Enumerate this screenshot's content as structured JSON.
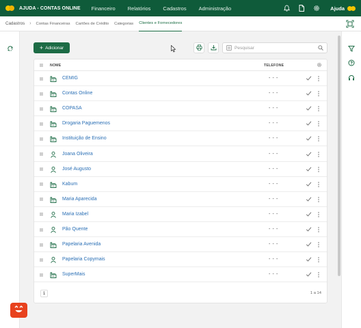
{
  "header": {
    "brand": "AJUDA - CONTAS ONLINE",
    "nav": [
      "Financeiro",
      "Relatórios",
      "Cadastros",
      "Administração"
    ],
    "help_label": "Ajuda",
    "icons": [
      "bell-icon",
      "document-icon",
      "gear-icon"
    ]
  },
  "tabs": {
    "breadcrumb": "Cadastros",
    "items": [
      "Contas Financeiras",
      "Cartões de Crédito",
      "Categorias",
      "Clientes e Fornecedores"
    ],
    "active": "Clientes e Fornecedores"
  },
  "toolbar": {
    "add_label": "Adicionar",
    "search_placeholder": "Pesquisar"
  },
  "table": {
    "columns": {
      "name": "NOME",
      "phone": "TELEFONE"
    },
    "rows": [
      {
        "name": "CEMIG",
        "phone": "- - -",
        "type": "company"
      },
      {
        "name": "Contas Online",
        "phone": "- - -",
        "type": "company"
      },
      {
        "name": "COPASA",
        "phone": "- - -",
        "type": "company"
      },
      {
        "name": "Drogaria Paguemenos",
        "phone": "- - -",
        "type": "company"
      },
      {
        "name": "Instituição de Ensino",
        "phone": "- - -",
        "type": "company"
      },
      {
        "name": "Joana Oliveira",
        "phone": "- - -",
        "type": "person"
      },
      {
        "name": "José Augusto",
        "phone": "- - -",
        "type": "person"
      },
      {
        "name": "Kabum",
        "phone": "- - -",
        "type": "company"
      },
      {
        "name": "Maria Aparecida",
        "phone": "- - -",
        "type": "company"
      },
      {
        "name": "Maria Izabel",
        "phone": "- - -",
        "type": "person"
      },
      {
        "name": "Pão Quente",
        "phone": "- - -",
        "type": "person"
      },
      {
        "name": "Papelaria Avenida",
        "phone": "- - -",
        "type": "company"
      },
      {
        "name": "Papelaria Copymais",
        "phone": "- - -",
        "type": "person"
      },
      {
        "name": "SuperMais",
        "phone": "- - -",
        "type": "company"
      }
    ]
  },
  "footer": {
    "page": "1",
    "count": "1 a 14"
  },
  "colors": {
    "topbar": "#0f5b3a",
    "accent": "#1c6b45",
    "link": "#2a6fb5",
    "bot": "#e8421e"
  }
}
